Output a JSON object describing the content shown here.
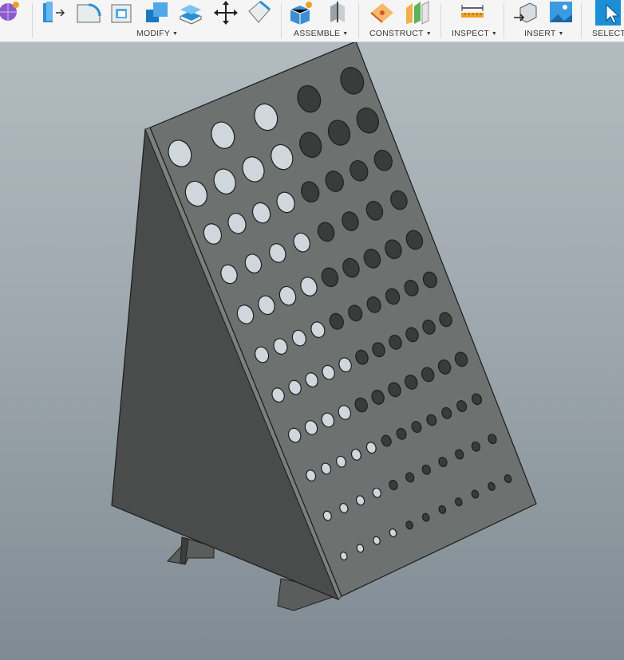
{
  "toolbar": {
    "groups": [
      {
        "id": "modify",
        "label": "MODIFY",
        "caret": "▼"
      },
      {
        "id": "assemble",
        "label": "ASSEMBLE",
        "caret": "▼"
      },
      {
        "id": "construct",
        "label": "CONSTRUCT",
        "caret": "▼"
      },
      {
        "id": "inspect",
        "label": "INSPECT",
        "caret": "▼"
      },
      {
        "id": "insert",
        "label": "INSERT",
        "caret": "▼"
      },
      {
        "id": "select",
        "label": "SELECT"
      }
    ],
    "tools": [
      {
        "name": "create-sphere-icon",
        "group": "create"
      },
      {
        "name": "press-pull-icon",
        "group": "modify"
      },
      {
        "name": "fillet-icon",
        "group": "modify"
      },
      {
        "name": "shell-icon",
        "group": "modify"
      },
      {
        "name": "combine-icon",
        "group": "modify"
      },
      {
        "name": "offset-face-icon",
        "group": "modify"
      },
      {
        "name": "move-copy-icon",
        "group": "modify"
      },
      {
        "name": "scale-icon",
        "group": "modify"
      },
      {
        "name": "new-component-icon",
        "group": "assemble"
      },
      {
        "name": "joint-icon",
        "group": "assemble"
      },
      {
        "name": "plane-at-angle-icon",
        "group": "construct"
      },
      {
        "name": "offset-plane-icon",
        "group": "construct"
      },
      {
        "name": "measure-icon",
        "group": "inspect"
      },
      {
        "name": "insert-mesh-icon",
        "group": "insert"
      },
      {
        "name": "insert-image-icon",
        "group": "insert"
      },
      {
        "name": "select-icon",
        "group": "select"
      }
    ]
  },
  "colors": {
    "toolbar_bg": "#f5f5f5",
    "accent_blue": "#1a8fd6",
    "accent_orange": "#f0a020",
    "accent_green": "#55b24a",
    "model_face": "#6d7271",
    "model_side": "#4a4c4b",
    "hole_open": "#cfd7dc",
    "hole_dark": "#3a3c3c"
  },
  "viewport": {
    "hole_rows": [
      {
        "holes": 5
      },
      {
        "holes": 7
      },
      {
        "holes": 8
      },
      {
        "holes": 8
      },
      {
        "holes": 9
      },
      {
        "holes": 10
      },
      {
        "holes": 11
      },
      {
        "holes": 11
      },
      {
        "holes": 12
      },
      {
        "holes": 11
      },
      {
        "holes": 11
      }
    ]
  }
}
